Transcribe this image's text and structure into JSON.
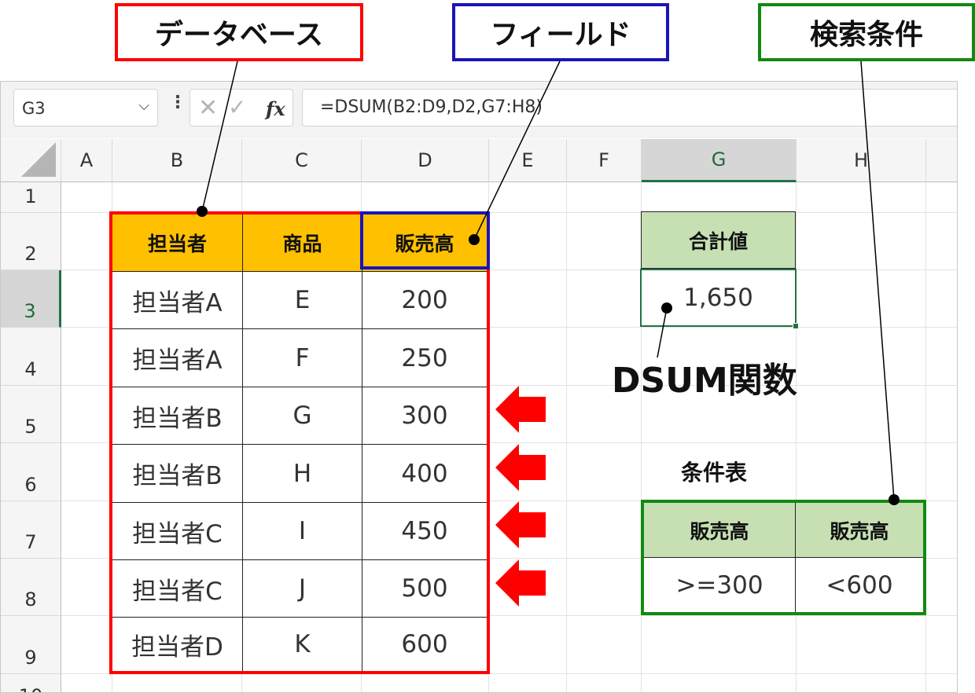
{
  "callouts": {
    "database": "データベース",
    "field": "フィールド",
    "criteria": "検索条件"
  },
  "formula_bar": {
    "name_box": "G3",
    "formula": "=DSUM(B2:D9,D2,G7:H8)",
    "fx_label": "fx"
  },
  "columns": [
    "A",
    "B",
    "C",
    "D",
    "E",
    "F",
    "G",
    "H"
  ],
  "selected_column": "G",
  "rows": [
    "1",
    "2",
    "3",
    "4",
    "5",
    "6",
    "7",
    "8",
    "9",
    "10"
  ],
  "selected_row": "3",
  "database": {
    "headers": [
      "担当者",
      "商品",
      "販売高"
    ],
    "rows": [
      [
        "担当者A",
        "E",
        "200"
      ],
      [
        "担当者A",
        "F",
        "250"
      ],
      [
        "担当者B",
        "G",
        "300"
      ],
      [
        "担当者B",
        "H",
        "400"
      ],
      [
        "担当者C",
        "I",
        "450"
      ],
      [
        "担当者C",
        "J",
        "500"
      ],
      [
        "担当者D",
        "K",
        "600"
      ]
    ]
  },
  "result": {
    "header": "合計値",
    "value": "1,650",
    "annotation": "DSUM関数"
  },
  "criteria_table": {
    "title": "条件表",
    "headers": [
      "販売高",
      "販売高"
    ],
    "values": [
      ">=300",
      "<600"
    ]
  },
  "colors": {
    "database_border": "#ff0000",
    "field_border": "#1a14b8",
    "criteria_border": "#108a10",
    "header_orange": "#ffc000",
    "header_green": "#c6e0b4",
    "arrow_red": "#ff0000"
  }
}
